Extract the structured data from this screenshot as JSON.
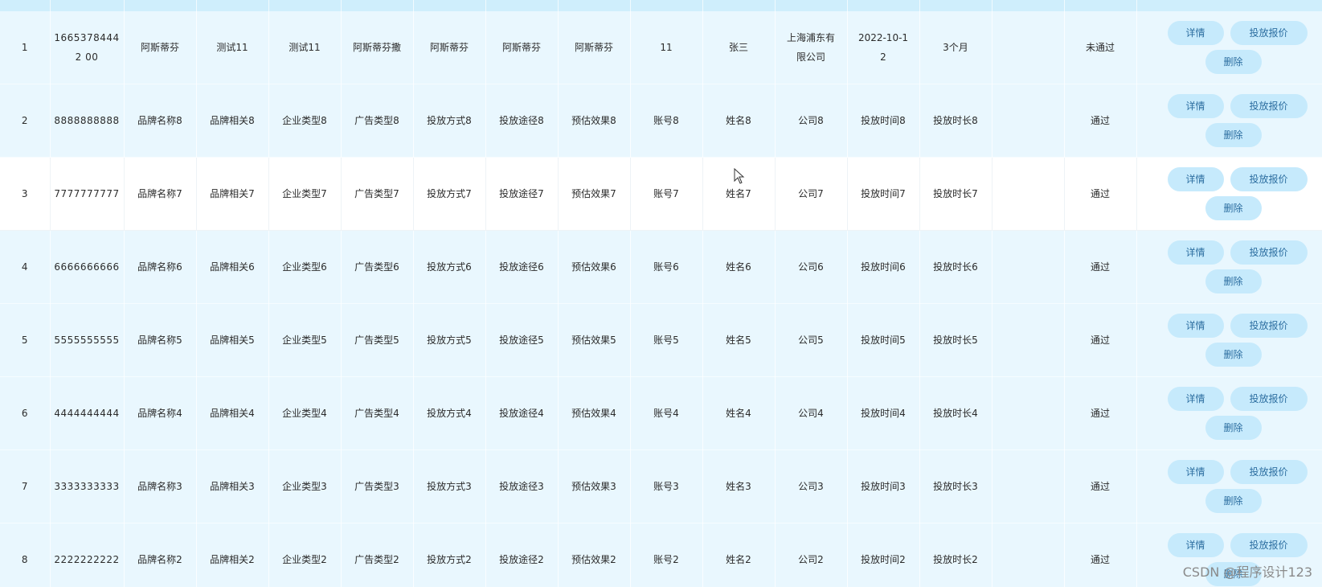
{
  "table": {
    "rows": [
      {
        "index": "1",
        "id": "16653784442 00",
        "brand_name": "阿斯蒂芬",
        "brand_related": "测试11",
        "company_type": "测试11",
        "ad_type": "阿斯蒂芬撒",
        "method": "阿斯蒂芬",
        "channel": "阿斯蒂芬",
        "effect": "阿斯蒂芬",
        "account": "11",
        "name": "张三",
        "company": "上海浦东有限公司",
        "time": "2022-10-12",
        "duration": "3个月",
        "extra": "",
        "status": "未通过"
      },
      {
        "index": "2",
        "id": "8888888888",
        "brand_name": "品牌名称8",
        "brand_related": "品牌相关8",
        "company_type": "企业类型8",
        "ad_type": "广告类型8",
        "method": "投放方式8",
        "channel": "投放途径8",
        "effect": "预估效果8",
        "account": "账号8",
        "name": "姓名8",
        "company": "公司8",
        "time": "投放时间8",
        "duration": "投放时长8",
        "extra": "",
        "status": "通过"
      },
      {
        "index": "3",
        "id": "7777777777",
        "brand_name": "品牌名称7",
        "brand_related": "品牌相关7",
        "company_type": "企业类型7",
        "ad_type": "广告类型7",
        "method": "投放方式7",
        "channel": "投放途径7",
        "effect": "预估效果7",
        "account": "账号7",
        "name": "姓名7",
        "company": "公司7",
        "time": "投放时间7",
        "duration": "投放时长7",
        "extra": "",
        "status": "通过"
      },
      {
        "index": "4",
        "id": "6666666666",
        "brand_name": "品牌名称6",
        "brand_related": "品牌相关6",
        "company_type": "企业类型6",
        "ad_type": "广告类型6",
        "method": "投放方式6",
        "channel": "投放途径6",
        "effect": "预估效果6",
        "account": "账号6",
        "name": "姓名6",
        "company": "公司6",
        "time": "投放时间6",
        "duration": "投放时长6",
        "extra": "",
        "status": "通过"
      },
      {
        "index": "5",
        "id": "5555555555",
        "brand_name": "品牌名称5",
        "brand_related": "品牌相关5",
        "company_type": "企业类型5",
        "ad_type": "广告类型5",
        "method": "投放方式5",
        "channel": "投放途径5",
        "effect": "预估效果5",
        "account": "账号5",
        "name": "姓名5",
        "company": "公司5",
        "time": "投放时间5",
        "duration": "投放时长5",
        "extra": "",
        "status": "通过"
      },
      {
        "index": "6",
        "id": "4444444444",
        "brand_name": "品牌名称4",
        "brand_related": "品牌相关4",
        "company_type": "企业类型4",
        "ad_type": "广告类型4",
        "method": "投放方式4",
        "channel": "投放途径4",
        "effect": "预估效果4",
        "account": "账号4",
        "name": "姓名4",
        "company": "公司4",
        "time": "投放时间4",
        "duration": "投放时长4",
        "extra": "",
        "status": "通过"
      },
      {
        "index": "7",
        "id": "3333333333",
        "brand_name": "品牌名称3",
        "brand_related": "品牌相关3",
        "company_type": "企业类型3",
        "ad_type": "广告类型3",
        "method": "投放方式3",
        "channel": "投放途径3",
        "effect": "预估效果3",
        "account": "账号3",
        "name": "姓名3",
        "company": "公司3",
        "time": "投放时间3",
        "duration": "投放时长3",
        "extra": "",
        "status": "通过"
      },
      {
        "index": "8",
        "id": "2222222222",
        "brand_name": "品牌名称2",
        "brand_related": "品牌相关2",
        "company_type": "企业类型2",
        "ad_type": "广告类型2",
        "method": "投放方式2",
        "channel": "投放途径2",
        "effect": "预估效果2",
        "account": "账号2",
        "name": "姓名2",
        "company": "公司2",
        "time": "投放时间2",
        "duration": "投放时长2",
        "extra": "",
        "status": "通过"
      }
    ]
  },
  "actions": {
    "detail_label": "详情",
    "quote_label": "投放报价",
    "delete_label": "删除"
  },
  "watermark": "CSDN @程序设计123",
  "colors": {
    "row_blue": "#e9f7fe",
    "row_white": "#ffffff",
    "button_bg": "#c6eafc",
    "button_text": "#2c6ea0"
  }
}
